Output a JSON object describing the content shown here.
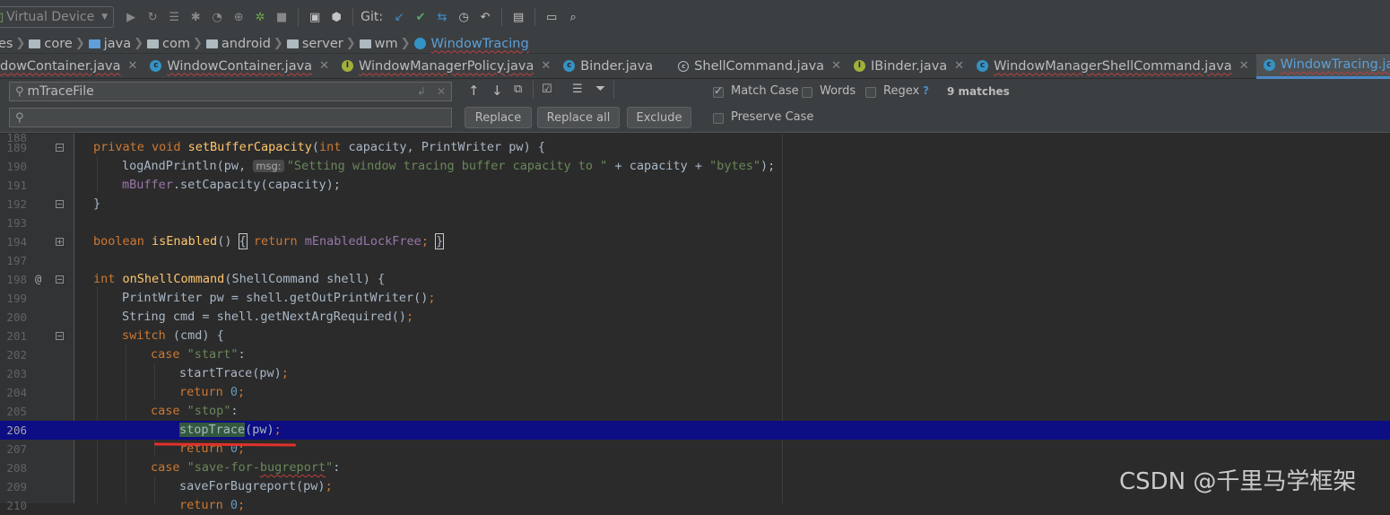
{
  "toolbar": {
    "device_selector": "Virtual Device",
    "git_label": "Git:"
  },
  "breadcrumb": [
    {
      "label": "es"
    },
    {
      "label": "core"
    },
    {
      "label": "java"
    },
    {
      "label": "com"
    },
    {
      "label": "android"
    },
    {
      "label": "server"
    },
    {
      "label": "wm"
    },
    {
      "label": "WindowTracing",
      "current": true
    }
  ],
  "tabs": [
    {
      "label": "dowContainer.java",
      "icon": "none",
      "closable": true
    },
    {
      "label": "WindowContainer.java",
      "icon": "class",
      "closable": true
    },
    {
      "label": "WindowManagerPolicy.java",
      "icon": "interface",
      "closable": true
    },
    {
      "label": "Binder.java",
      "icon": "class",
      "closable": false
    },
    {
      "label": "ShellCommand.java",
      "icon": "abstract",
      "closable": true
    },
    {
      "label": "IBinder.java",
      "icon": "interface",
      "closable": true
    },
    {
      "label": "WindowManagerShellCommand.java",
      "icon": "class",
      "closable": true
    },
    {
      "label": "WindowTracing.java",
      "icon": "class",
      "closable": true,
      "active": true
    }
  ],
  "find": {
    "search_value": "mTraceFile",
    "replace_value": "",
    "replace_label": "Replace",
    "replace_all_label": "Replace all",
    "exclude_label": "Exclude",
    "match_case_label": "Match Case",
    "match_case_checked": true,
    "words_label": "Words",
    "words_checked": false,
    "regex_label": "Regex",
    "regex_checked": false,
    "regex_help": "?",
    "preserve_case_label": "Preserve Case",
    "preserve_case_checked": false,
    "matches": "9 matches"
  },
  "editor": {
    "current_line": "206",
    "lines": [
      {
        "num": "189",
        "text": "private void setBufferCapacity(int capacity, PrintWriter pw) {"
      },
      {
        "num": "190",
        "text": "logAndPrintln(pw, msg: \"Setting window tracing buffer capacity to \" + capacity + \"bytes\");"
      },
      {
        "num": "191",
        "text": "mBuffer.setCapacity(capacity);"
      },
      {
        "num": "192",
        "text": "}"
      },
      {
        "num": "193",
        "text": ""
      },
      {
        "num": "194",
        "text": "boolean isEnabled() { return mEnabledLockFree; }"
      },
      {
        "num": "197",
        "text": ""
      },
      {
        "num": "198",
        "text": "int onShellCommand(ShellCommand shell) {"
      },
      {
        "num": "199",
        "text": "PrintWriter pw = shell.getOutPrintWriter();"
      },
      {
        "num": "200",
        "text": "String cmd = shell.getNextArgRequired();"
      },
      {
        "num": "201",
        "text": "switch (cmd) {"
      },
      {
        "num": "202",
        "text": "case \"start\":"
      },
      {
        "num": "203",
        "text": "startTrace(pw);"
      },
      {
        "num": "204",
        "text": "return 0;"
      },
      {
        "num": "205",
        "text": "case \"stop\":"
      },
      {
        "num": "206",
        "text": "stopTrace(pw);"
      },
      {
        "num": "207",
        "text": "return 0;"
      },
      {
        "num": "208",
        "text": "case \"save-for-bugreport\":"
      },
      {
        "num": "209",
        "text": "saveForBugreport(pw);"
      },
      {
        "num": "210",
        "text": "return 0;"
      }
    ]
  },
  "watermark": "CSDN @千里马学框架"
}
